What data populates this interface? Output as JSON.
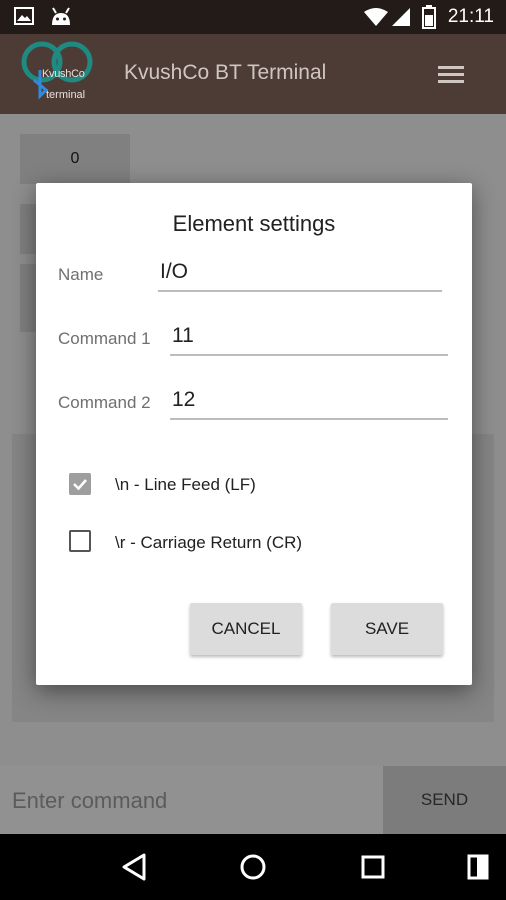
{
  "status_bar": {
    "time": "21:11"
  },
  "app_bar": {
    "title": "KvushCo BT Terminal",
    "logo_line1": "KvushCo",
    "logo_line2": "terminal"
  },
  "main": {
    "buttons": [
      {
        "label": "0"
      }
    ]
  },
  "command_bar": {
    "placeholder": "Enter command",
    "send_label": "SEND"
  },
  "dialog": {
    "title": "Element settings",
    "fields": [
      {
        "label": "Name",
        "value": "I/O"
      },
      {
        "label": "Command 1",
        "value": "11"
      },
      {
        "label": "Command 2",
        "value": "12"
      }
    ],
    "checkboxes": [
      {
        "label": "\\n - Line Feed (LF)",
        "checked": true
      },
      {
        "label": "\\r - Carriage Return (CR)",
        "checked": false
      }
    ],
    "cancel_label": "CANCEL",
    "save_label": "SAVE"
  },
  "colors": {
    "app_bar": "#4d3c35",
    "status_bar": "#231b18",
    "logo": "#1f8a82"
  }
}
